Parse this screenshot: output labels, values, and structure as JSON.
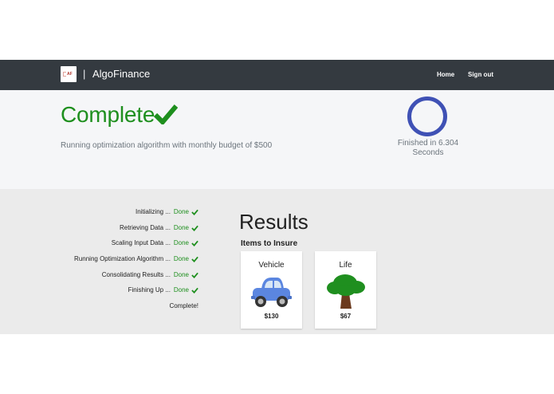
{
  "navbar": {
    "logo_text": "AF",
    "separator": "|",
    "brand": "AlgoFinance",
    "links": [
      {
        "label": "Home"
      },
      {
        "label": "Sign out"
      }
    ]
  },
  "hero": {
    "title": "Complete",
    "subtitle": "Running optimization algorithm with monthly budget of $500",
    "finished_text": "Finished in 6.304 Seconds"
  },
  "steps": [
    {
      "label": "Initializing ...",
      "status": "Done"
    },
    {
      "label": "Retrieving Data ...",
      "status": "Done"
    },
    {
      "label": "Scaling Input Data ...",
      "status": "Done"
    },
    {
      "label": "Running Optimization Algorithm ...",
      "status": "Done"
    },
    {
      "label": "Consolidating Results ...",
      "status": "Done"
    },
    {
      "label": "Finishing Up ...",
      "status": "Done"
    }
  ],
  "final_step": "Complete!",
  "results": {
    "title": "Results",
    "items_heading": "Items to Insure",
    "items": [
      {
        "name": "Vehicle",
        "price": "$130",
        "icon": "car-icon"
      },
      {
        "name": "Life",
        "price": "$67",
        "icon": "tree-icon"
      }
    ]
  },
  "colors": {
    "navbar": "#343a40",
    "success": "#1e8f1e",
    "ring": "#3f51b5",
    "car": "#5b86e0",
    "tree_leaf": "#1f8f1f",
    "tree_trunk": "#6b3a1e"
  }
}
